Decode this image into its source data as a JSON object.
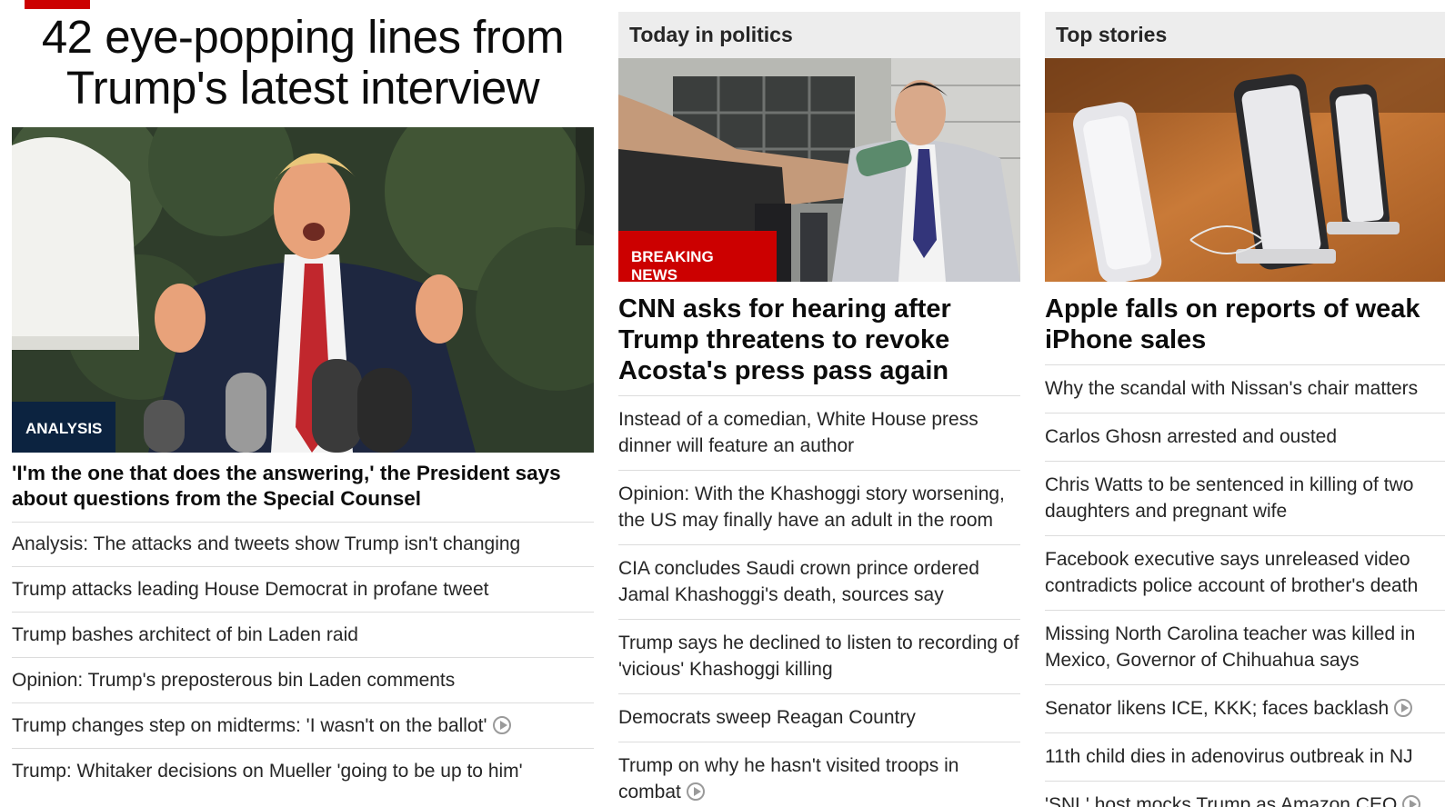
{
  "left_zone": {
    "hero_title": "42 eye-popping lines from Trump's latest interview",
    "badge": "ANALYSIS",
    "lead_headline": "'I'm the one that does the answering,' the President says about questions from the Special Counsel",
    "items": [
      {
        "text": "Analysis: The attacks and tweets show Trump isn't changing",
        "video": false
      },
      {
        "text": "Trump attacks leading House Democrat in profane tweet",
        "video": false
      },
      {
        "text": "Trump bashes architect of bin Laden raid",
        "video": false
      },
      {
        "text": "Opinion: Trump's preposterous bin Laden comments",
        "video": false
      },
      {
        "text": "Trump changes step on midterms: 'I wasn't on the ballot'",
        "video": true
      },
      {
        "text": "Trump: Whitaker decisions on Mueller 'going to be up to him'",
        "video": false
      }
    ]
  },
  "mid_zone": {
    "header": "Today in politics",
    "badge": "BREAKING NEWS",
    "lead_headline": "CNN asks for hearing after Trump threatens to revoke Acosta's press pass again",
    "items": [
      {
        "text": "Instead of a comedian, White House press dinner will feature an author",
        "video": false
      },
      {
        "text": "Opinion: With the Khashoggi story worsening, the US may finally have an adult in the room",
        "video": false
      },
      {
        "text": "CIA concludes Saudi crown prince ordered Jamal Khashoggi's death, sources say",
        "video": false
      },
      {
        "text": "Trump says he declined to listen to recording of 'vicious' Khashoggi killing",
        "video": false
      },
      {
        "text": "Democrats sweep Reagan Country",
        "video": false
      },
      {
        "text": "Trump on why he hasn't visited troops in combat",
        "video": true
      }
    ]
  },
  "right_zone": {
    "header": "Top stories",
    "lead_headline": "Apple falls on reports of weak iPhone sales",
    "items": [
      {
        "text": "Why the scandal with Nissan's chair matters",
        "video": false
      },
      {
        "text": "Carlos Ghosn arrested and ousted",
        "video": false
      },
      {
        "text": "Chris Watts to be sentenced in killing of two daughters and pregnant wife",
        "video": false
      },
      {
        "text": "Facebook executive says unreleased video contradicts police account of brother's death",
        "video": false
      },
      {
        "text": "Missing North Carolina teacher was killed in Mexico, Governor of Chihuahua says",
        "video": false
      },
      {
        "text": "Senator likens ICE, KKK; faces backlash",
        "video": true
      },
      {
        "text": "11th child dies in adenovirus outbreak in NJ",
        "video": false
      },
      {
        "text": "'SNL' host mocks Trump as Amazon CEO",
        "video": true
      }
    ]
  },
  "colors": {
    "accent": "#cc0000",
    "analysis_badge": "#0c2340",
    "header_bg": "#ededed"
  }
}
